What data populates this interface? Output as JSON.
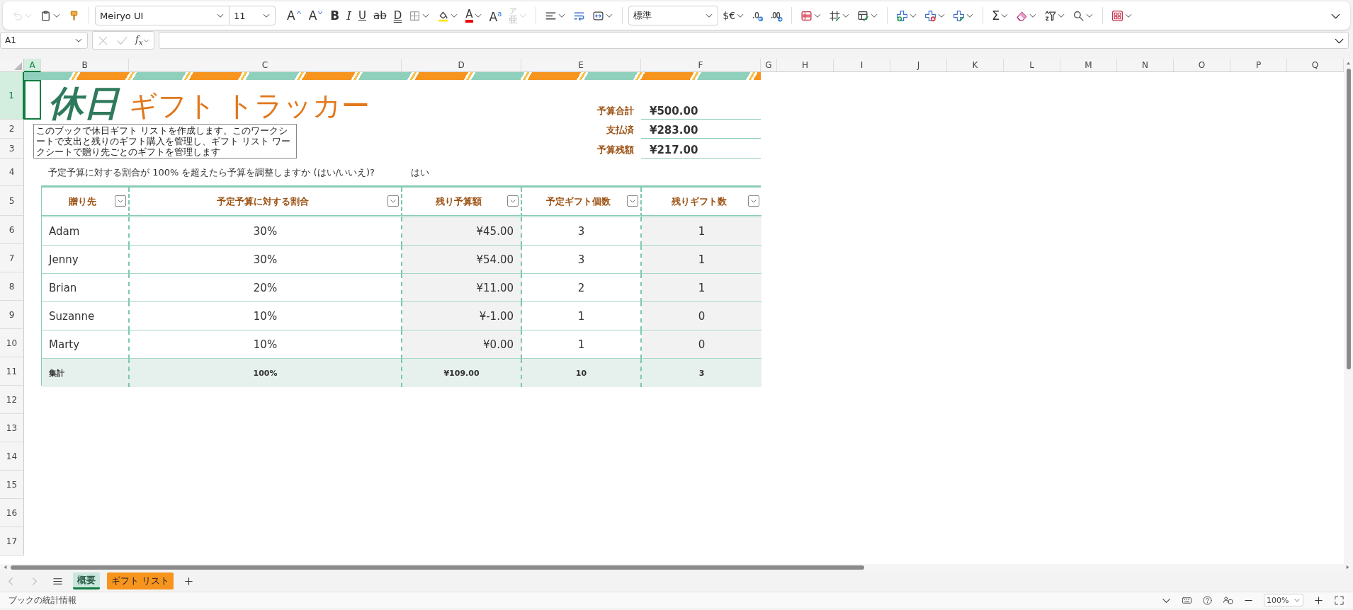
{
  "toolbar": {
    "groups": [
      [
        {
          "kind": "undo",
          "disabled": true,
          "menu": true
        },
        {
          "kind": "paste",
          "disabled": false,
          "menu": true
        },
        {
          "kind": "painter",
          "disabled": false,
          "menu": false
        }
      ],
      [
        {
          "kind": "fontname",
          "value": "Meiryo UI",
          "disabled": false,
          "menu": true
        },
        {
          "kind": "fontsize",
          "value": "11",
          "disabled": false,
          "menu": true
        },
        {
          "kind": "grow",
          "label": "A",
          "disabled": false,
          "menu": false
        },
        {
          "kind": "shrink",
          "label": "A",
          "disabled": false,
          "menu": false
        },
        {
          "kind": "bold",
          "label": "B",
          "disabled": false,
          "menu": false
        },
        {
          "kind": "italic",
          "label": "I",
          "disabled": false,
          "menu": false
        },
        {
          "kind": "underline",
          "label": "U",
          "disabled": false,
          "menu": false
        },
        {
          "kind": "strike",
          "label": "ab",
          "disabled": false,
          "menu": false
        },
        {
          "kind": "dunderline",
          "label": "D",
          "disabled": false,
          "menu": false
        },
        {
          "kind": "borders",
          "disabled": false,
          "menu": true
        },
        {
          "kind": "fill",
          "disabled": false,
          "menu": true
        },
        {
          "kind": "fontcolor",
          "label": "A",
          "disabled": false,
          "menu": true
        },
        {
          "kind": "superscript",
          "label": "A$^{a}$",
          "disabled": false,
          "menu": false
        },
        {
          "kind": "phonetic",
          "label": "亜",
          "ruby": "ア",
          "disabled": true,
          "menu": true
        }
      ],
      [
        {
          "kind": "align",
          "disabled": false,
          "menu": true
        },
        {
          "kind": "wrap",
          "disabled": false,
          "menu": false
        },
        {
          "kind": "merge",
          "disabled": false,
          "menu": true
        }
      ],
      [
        {
          "kind": "numformat",
          "value": "標準",
          "disabled": false,
          "menu": true
        },
        {
          "kind": "currency",
          "label": "$€",
          "disabled": false,
          "menu": true
        },
        {
          "kind": "decdec",
          "disabled": false,
          "menu": false
        },
        {
          "kind": "incdec",
          "disabled": false,
          "menu": false
        }
      ],
      [
        {
          "kind": "condformat",
          "disabled": false,
          "menu": true
        },
        {
          "kind": "tableformat",
          "disabled": false,
          "menu": true
        },
        {
          "kind": "cellstyles",
          "disabled": false,
          "menu": true
        }
      ],
      [
        {
          "kind": "insert",
          "disabled": false,
          "menu": true
        },
        {
          "kind": "delete",
          "disabled": false,
          "menu": true
        },
        {
          "kind": "cellformat",
          "disabled": false,
          "menu": true
        }
      ],
      [
        {
          "kind": "sum",
          "label": "Σ",
          "disabled": false,
          "menu": true
        },
        {
          "kind": "clear",
          "disabled": false,
          "menu": true
        },
        {
          "kind": "sort",
          "disabled": false,
          "menu": true
        },
        {
          "kind": "find",
          "disabled": false,
          "menu": true
        }
      ],
      [
        {
          "kind": "addins",
          "disabled": false,
          "menu": true
        }
      ]
    ]
  },
  "formula_bar": {
    "name_box": "A1",
    "buttons": [
      {
        "kind": "cancel",
        "disabled": true
      },
      {
        "kind": "enter",
        "disabled": true
      },
      {
        "kind": "function",
        "label": "f$_{x}$",
        "disabled": false
      }
    ]
  },
  "columns": [
    {
      "label": "A",
      "selected": true
    },
    {
      "label": "B",
      "selected": false
    },
    {
      "label": "C",
      "selected": false
    },
    {
      "label": "D",
      "selected": false
    },
    {
      "label": "E",
      "selected": false
    },
    {
      "label": "F",
      "selected": false
    },
    {
      "label": "G",
      "selected": false
    },
    {
      "label": "H",
      "selected": false
    },
    {
      "label": "I",
      "selected": false
    },
    {
      "label": "J",
      "selected": false
    },
    {
      "label": "K",
      "selected": false
    },
    {
      "label": "L",
      "selected": false
    },
    {
      "label": "M",
      "selected": false
    },
    {
      "label": "N",
      "selected": false
    },
    {
      "label": "O",
      "selected": false
    },
    {
      "label": "P",
      "selected": false
    },
    {
      "label": "Q",
      "selected": false
    }
  ],
  "rows": [
    {
      "label": "1",
      "selected": true
    },
    {
      "label": "2",
      "selected": false
    },
    {
      "label": "3",
      "selected": false
    },
    {
      "label": "4",
      "selected": false
    },
    {
      "label": "5",
      "selected": false
    },
    {
      "label": "6",
      "selected": false
    },
    {
      "label": "7",
      "selected": false
    },
    {
      "label": "8",
      "selected": false
    },
    {
      "label": "9",
      "selected": false
    },
    {
      "label": "10",
      "selected": false
    },
    {
      "label": "11",
      "selected": false
    },
    {
      "label": "12",
      "selected": false
    },
    {
      "label": "13",
      "selected": false
    },
    {
      "label": "14",
      "selected": false
    },
    {
      "label": "15",
      "selected": false
    },
    {
      "label": "16",
      "selected": false
    },
    {
      "label": "17",
      "selected": false
    }
  ],
  "title": {
    "highlight": "休日",
    "text": "ギフト トラッカー"
  },
  "comment": "このブックで休日ギフト リストを作成します。このワークシートで支出と残りのギフト購入を管理し、ギフト リスト ワークシートで贈り先ごとのギフトを管理します",
  "summary": [
    {
      "label": "予算合計",
      "value": "¥500.00"
    },
    {
      "label": "支払済",
      "value": "¥283.00"
    },
    {
      "label": "予算残額",
      "value": "¥217.00"
    }
  ],
  "question": {
    "text": "予定予算に対する割合が 100% を超えたら予算を調整しますか (はい/いいえ)?",
    "answer": "はい"
  },
  "table": {
    "columns": [
      {
        "label": "贈り先"
      },
      {
        "label": "予定予算に対する割合"
      },
      {
        "label": "残り予算額"
      },
      {
        "label": "予定ギフト個数"
      },
      {
        "label": "残りギフト数"
      }
    ],
    "rows": [
      [
        "Adam",
        "30%",
        "¥45.00",
        "3",
        "1"
      ],
      [
        "Jenny",
        "30%",
        "¥54.00",
        "3",
        "1"
      ],
      [
        "Brian",
        "20%",
        "¥11.00",
        "2",
        "1"
      ],
      [
        "Suzanne",
        "10%",
        "¥-1.00",
        "1",
        "0"
      ],
      [
        "Marty",
        "10%",
        "¥0.00",
        "1",
        "0"
      ]
    ],
    "total": [
      "集計",
      "100%",
      "¥109.00",
      "10",
      "3"
    ]
  },
  "sheet_tabs": [
    {
      "label": "概要",
      "selected": true,
      "color": "#c9e7dd"
    },
    {
      "label": "ギフト リスト",
      "selected": false,
      "color": "#f7941d"
    }
  ],
  "status_bar": {
    "text": "ブックの統計情報",
    "zoom": "100%"
  }
}
